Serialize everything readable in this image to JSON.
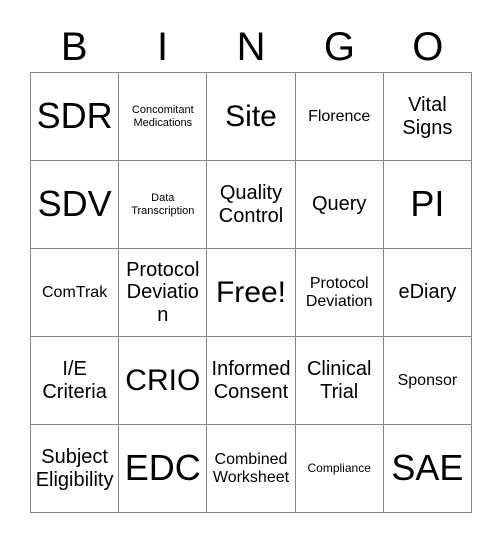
{
  "card": {
    "title": "BINGO",
    "header_letters": [
      "B",
      "I",
      "N",
      "G",
      "O"
    ],
    "colors": {
      "background": "#ffffff",
      "text": "#000000",
      "gridline": "#858585"
    },
    "rows": [
      [
        {
          "label": "SDR",
          "size": "xl"
        },
        {
          "label": "Concomitant Medications",
          "size": "xxs"
        },
        {
          "label": "Site",
          "size": "lg"
        },
        {
          "label": "Florence",
          "size": "sm"
        },
        {
          "label": "Vital Signs",
          "size": "md"
        }
      ],
      [
        {
          "label": "SDV",
          "size": "xl"
        },
        {
          "label": "Data Transcription",
          "size": "xxs"
        },
        {
          "label": "Quality Control",
          "size": "md"
        },
        {
          "label": "Query",
          "size": "md"
        },
        {
          "label": "PI",
          "size": "xl"
        }
      ],
      [
        {
          "label": "ComTrak",
          "size": "sm"
        },
        {
          "label": "Protocol Deviation",
          "size": "md"
        },
        {
          "label": "Free!",
          "size": "lg"
        },
        {
          "label": "Protocol Deviation",
          "size": "sm"
        },
        {
          "label": "eDiary",
          "size": "md"
        }
      ],
      [
        {
          "label": "I/E Criteria",
          "size": "md"
        },
        {
          "label": "CRIO",
          "size": "lg"
        },
        {
          "label": "Informed Consent",
          "size": "md"
        },
        {
          "label": "Clinical Trial",
          "size": "md"
        },
        {
          "label": "Sponsor",
          "size": "sm"
        }
      ],
      [
        {
          "label": "Subject Eligibility",
          "size": "md"
        },
        {
          "label": "EDC",
          "size": "xl"
        },
        {
          "label": "Combined Worksheet",
          "size": "sm"
        },
        {
          "label": "Compliance",
          "size": "xs"
        },
        {
          "label": "SAE",
          "size": "xl"
        }
      ]
    ]
  }
}
